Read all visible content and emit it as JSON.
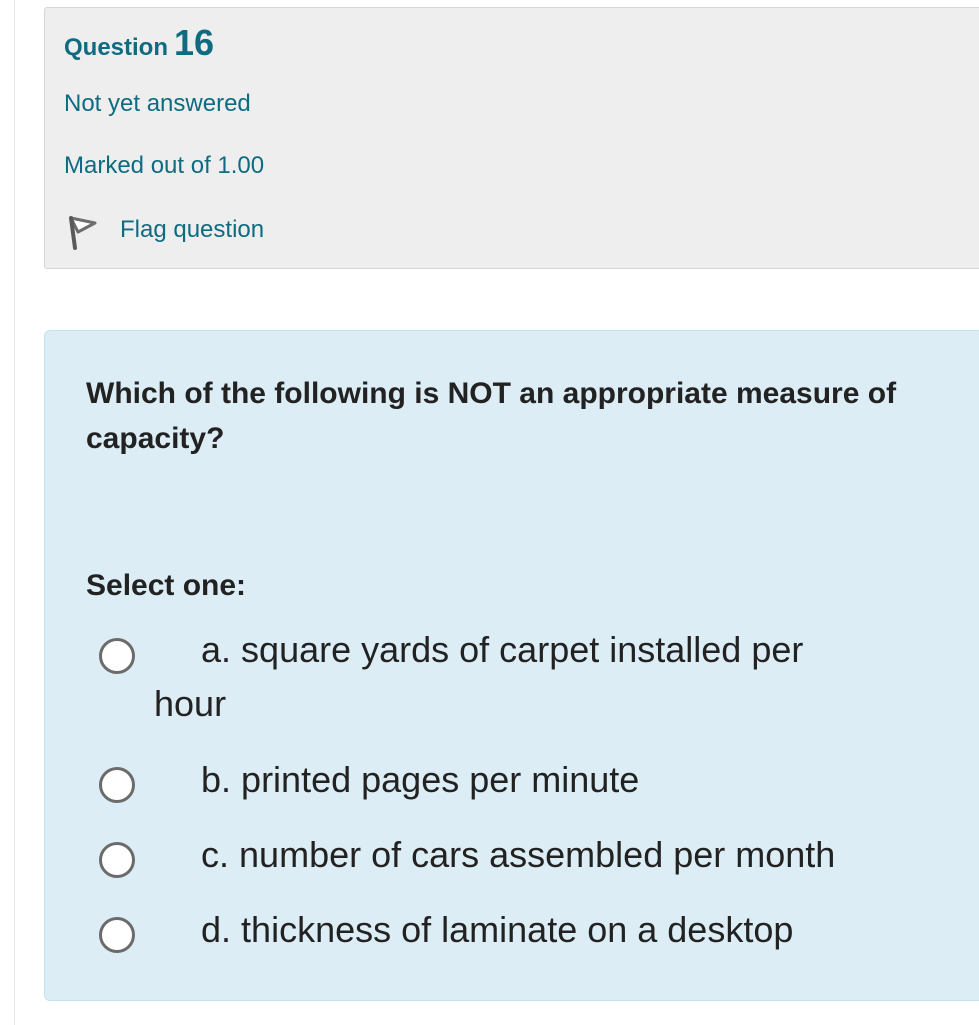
{
  "info": {
    "question_word": "Question",
    "question_number": "16",
    "state": "Not yet answered",
    "grade": "Marked out of 1.00",
    "flag_label": "Flag question",
    "flag_icon": "flag-icon"
  },
  "question": {
    "text": "Which of the following is NOT an appropriate measure of capacity?",
    "prompt": "Select one:",
    "options": [
      {
        "letter": "a.",
        "text": "square yards of carpet installed per",
        "text_cont": "hour",
        "selected": false
      },
      {
        "letter": "b.",
        "text": "printed pages per minute",
        "selected": false
      },
      {
        "letter": "c.",
        "text": "number of cars assembled per month",
        "selected": false
      },
      {
        "letter": "d.",
        "text": "thickness of laminate on a desktop",
        "selected": false
      }
    ]
  },
  "colors": {
    "info_text": "#0f6b80",
    "info_bg": "#eeeeee",
    "formulation_bg": "#dcedf5",
    "body_text": "#222222"
  }
}
